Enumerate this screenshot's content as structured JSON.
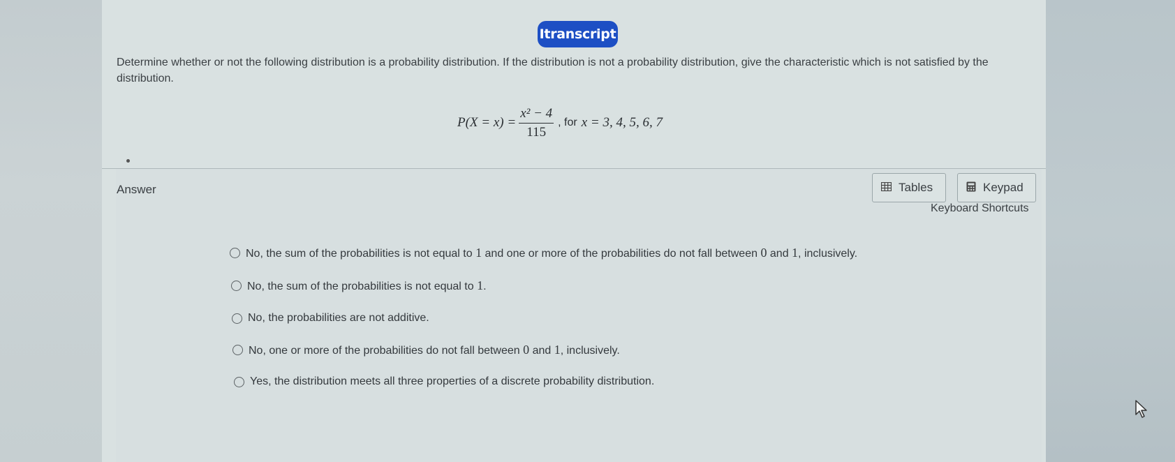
{
  "header": {
    "badge": "Itranscript"
  },
  "question": {
    "text": "Determine whether or not the following distribution is a probability distribution. If the distribution is not a probability distribution, give the characteristic which is not satisfied by the distribution."
  },
  "formula": {
    "lhs": "P(X = x) =",
    "numerator": "x² − 4",
    "denominator": "115",
    "for_text": ", for",
    "range": "x = 3, 4, 5, 6, 7"
  },
  "answer": {
    "label": "Answer",
    "tables_label": "Tables",
    "keypad_label": "Keypad",
    "shortcuts_label": "Keyboard Shortcuts"
  },
  "options": [
    {
      "pre": "No, the sum of the probabilities is not equal to ",
      "n1": "1",
      "mid": " and one or more of the probabilities do not fall between ",
      "n2": "0",
      "and": " and ",
      "n3": "1",
      "post": ", inclusively."
    },
    {
      "pre": "No, the sum of the probabilities is not equal to ",
      "n1": "1",
      "post": "."
    },
    {
      "text": "No, the probabilities are not additive."
    },
    {
      "pre": "No, one or more of the probabilities do not fall between ",
      "n1": "0",
      "and": " and ",
      "n2": "1",
      "post": ", inclusively."
    },
    {
      "text": "Yes, the distribution meets all three properties of a discrete probability distribution."
    }
  ],
  "icons": {
    "tables": "table-icon",
    "keypad": "calculator-icon",
    "cursor": "mouse-pointer-icon"
  }
}
